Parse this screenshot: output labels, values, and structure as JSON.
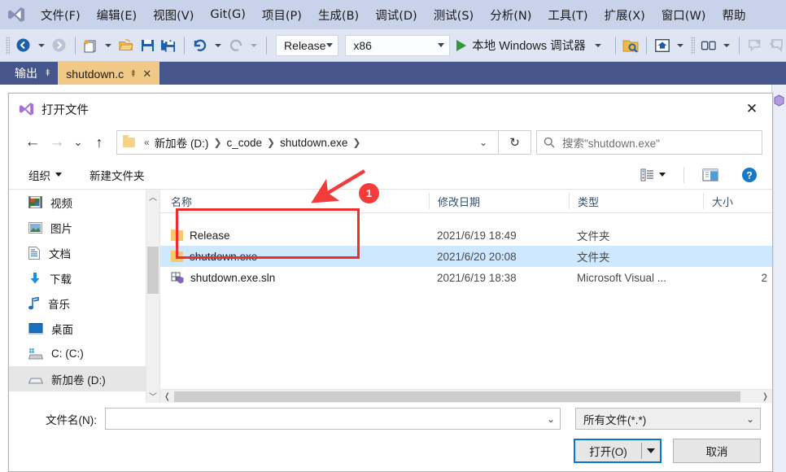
{
  "ide": {
    "menu": [
      {
        "label": "文件(F)",
        "name": "menu-file"
      },
      {
        "label": "编辑(E)",
        "name": "menu-edit"
      },
      {
        "label": "视图(V)",
        "name": "menu-view"
      },
      {
        "label": "Git(G)",
        "name": "menu-git"
      },
      {
        "label": "项目(P)",
        "name": "menu-project"
      },
      {
        "label": "生成(B)",
        "name": "menu-build"
      },
      {
        "label": "调试(D)",
        "name": "menu-debug"
      },
      {
        "label": "测试(S)",
        "name": "menu-test"
      },
      {
        "label": "分析(N)",
        "name": "menu-analyze"
      },
      {
        "label": "工具(T)",
        "name": "menu-tools"
      },
      {
        "label": "扩展(X)",
        "name": "menu-extensions"
      },
      {
        "label": "窗口(W)",
        "name": "menu-window"
      },
      {
        "label": "帮助",
        "name": "menu-help"
      }
    ],
    "toolbar": {
      "configuration": "Release",
      "platform": "x86",
      "run_label": "本地 Windows 调试器"
    },
    "tabs": {
      "output_tab": "输出",
      "document_tab": "shutdown.c"
    }
  },
  "dialog": {
    "title": "打开文件",
    "close_label": "✕",
    "breadcrumb": {
      "prefix": "«",
      "parts": [
        "新加卷 (D:)",
        "c_code",
        "shutdown.exe"
      ]
    },
    "search": {
      "placeholder": "搜索\"shutdown.exe\""
    },
    "commandbar": {
      "organize": "组织",
      "new_folder": "新建文件夹"
    },
    "nav_items": [
      {
        "label": "视频",
        "icon": "video-icon"
      },
      {
        "label": "图片",
        "icon": "pictures-icon"
      },
      {
        "label": "文档",
        "icon": "documents-icon"
      },
      {
        "label": "下载",
        "icon": "downloads-icon"
      },
      {
        "label": "音乐",
        "icon": "music-icon"
      },
      {
        "label": "桌面",
        "icon": "desktop-icon"
      },
      {
        "label": "C: (C:)",
        "icon": "windows-drive-icon"
      },
      {
        "label": "新加卷 (D:)",
        "icon": "drive-icon"
      }
    ],
    "columns": [
      "名称",
      "修改日期",
      "类型",
      "大小"
    ],
    "files": [
      {
        "name": "Release",
        "date": "2021/6/19 18:49",
        "type": "文件夹",
        "size": "",
        "icon": "folder-icon",
        "selected": false
      },
      {
        "name": "shutdown.exe",
        "date": "2021/6/20 20:08",
        "type": "文件夹",
        "size": "",
        "icon": "folder-icon",
        "selected": true
      },
      {
        "name": "shutdown.exe.sln",
        "date": "2021/6/19 18:38",
        "type": "Microsoft Visual ...",
        "size": "2",
        "icon": "solution-icon",
        "selected": false
      }
    ],
    "footer": {
      "filename_label": "文件名(N):",
      "filename_value": "",
      "filetype_value": "所有文件(*.*)",
      "open_button": "打开(O)",
      "cancel_button": "取消"
    }
  },
  "annotations": [
    {
      "label": "1",
      "name": "annotation-badge-1"
    }
  ],
  "colors": {
    "accent": "#0078d7",
    "annotation": "#f43b3b",
    "selection": "#cde8ff",
    "menubar": "#c8d3ea",
    "tabstrip": "#46568c",
    "doc_tab": "#f0c987"
  }
}
